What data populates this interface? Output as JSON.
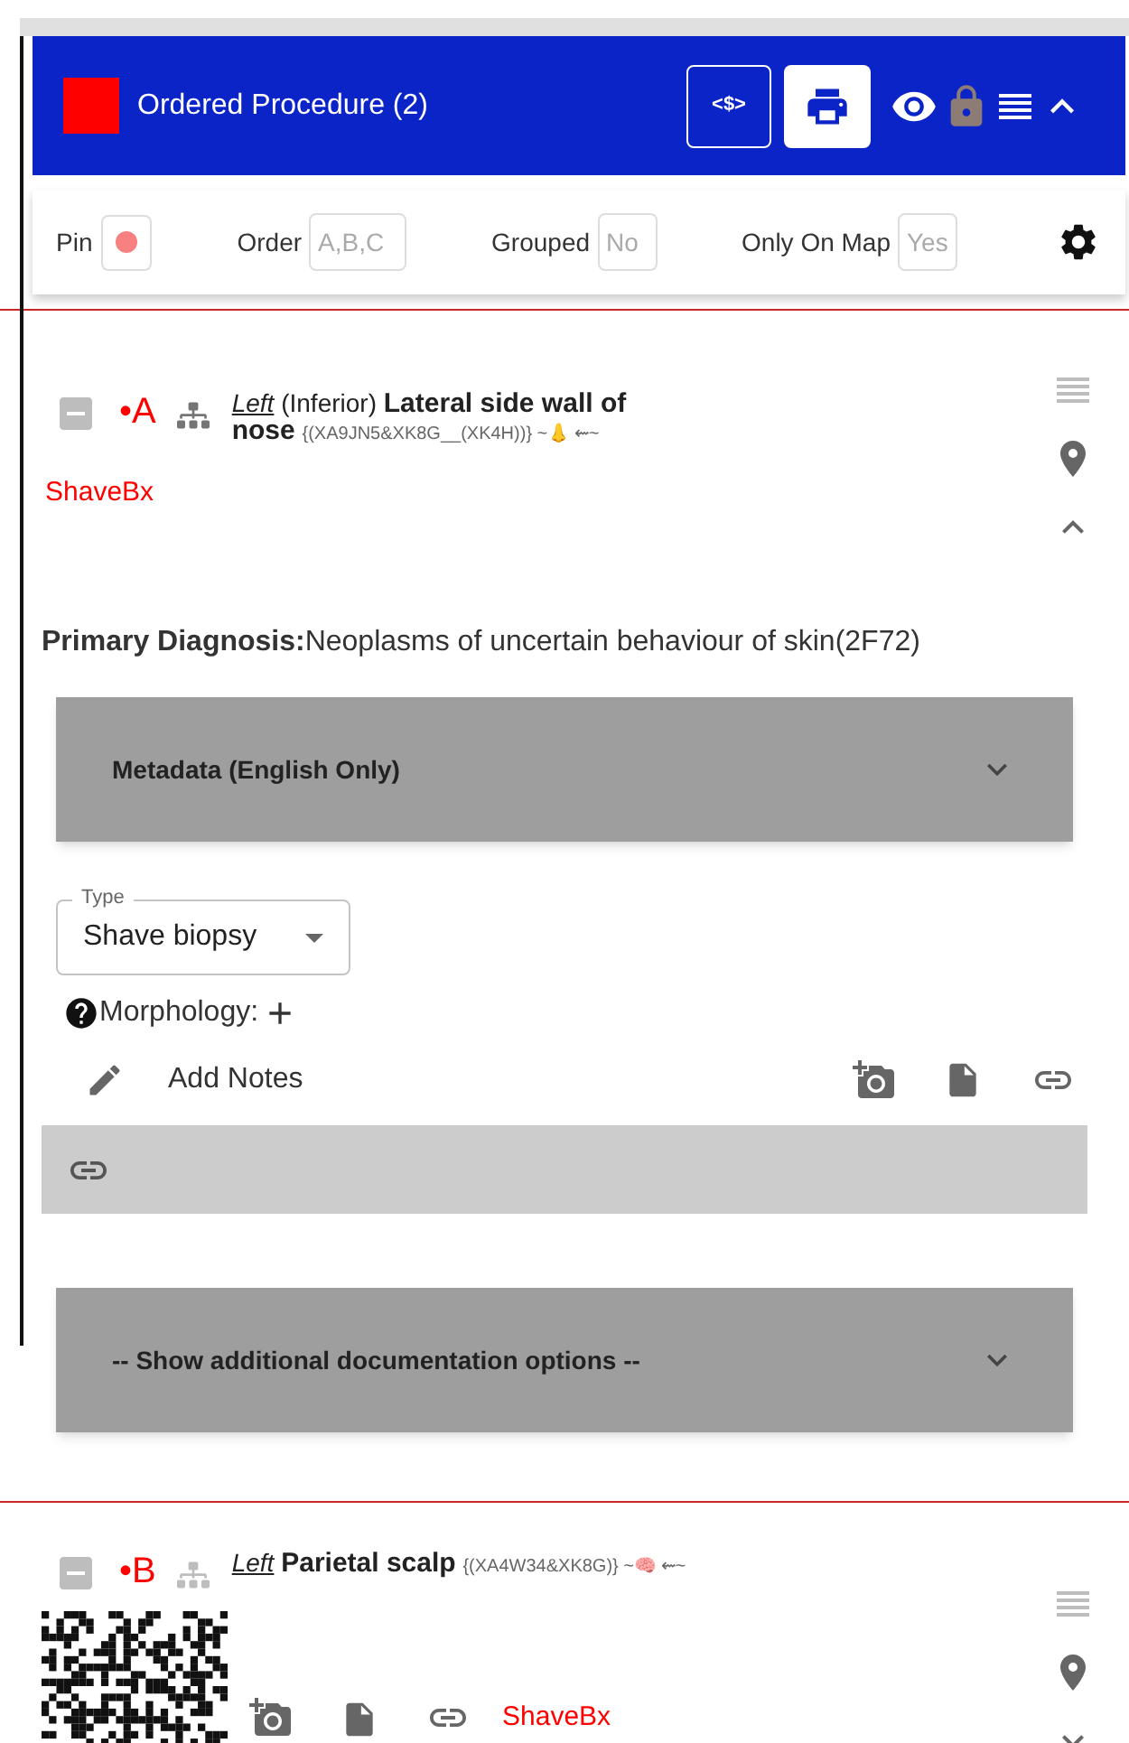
{
  "header": {
    "title": "Ordered Procedure (2)",
    "price_button": "<$>"
  },
  "toolbar": {
    "pin_label": "Pin",
    "fields": [
      {
        "label": "Order",
        "placeholder": "A,B,C"
      },
      {
        "label": "Grouped",
        "placeholder": "No"
      },
      {
        "label": "Only On Map",
        "placeholder": "Yes"
      }
    ]
  },
  "procedures": [
    {
      "letter": "•A",
      "title": "*Left* (Inferior) **Lateral side wall of nose**",
      "code": "{(XA9JN5&XK8G__(XK4H))} ~👃 ⇜~",
      "tag": "ShaveBx",
      "expanded": true,
      "diagnosis_label": "Primary Diagnosis:",
      "diagnosis": "Neoplasms of uncertain behaviour of skin(2F72)",
      "metadata": "Metadata (English Only)",
      "type_label": "Type",
      "type_value": "Shave biopsy",
      "morphology": "Morphology:",
      "notes": "Add Notes",
      "more_options": "-- Show additional documentation options --"
    },
    {
      "letter": "•B",
      "title": "*Left* **Parietal scalp**",
      "code": "{(XA4W34&XK8G)} ~🧠 ⇜~",
      "tag": "ShaveBx",
      "expanded": false
    }
  ]
}
